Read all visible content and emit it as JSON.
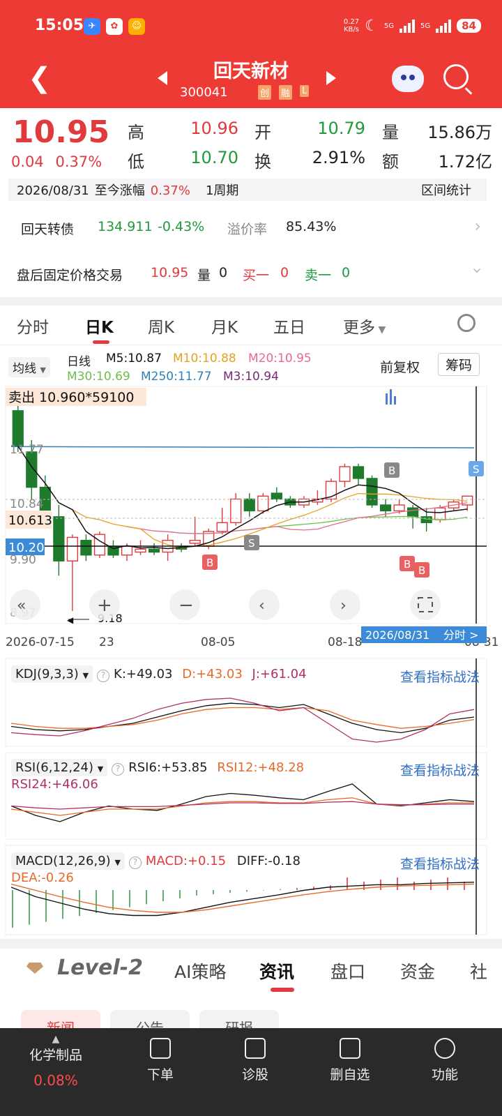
{
  "status": {
    "time": "15:05",
    "net_speed": "0.27",
    "net_unit": "KB/s",
    "sig1": "5G",
    "sig2": "5G",
    "battery": "84"
  },
  "nav": {
    "title": "回天新材",
    "code": "300041",
    "tags": [
      "创",
      "融",
      "L"
    ]
  },
  "quote": {
    "price": "10.95",
    "change": "0.04",
    "change_pct": "0.37%",
    "high_label": "高",
    "high": "10.96",
    "open_label": "开",
    "open": "10.79",
    "vol_label": "量",
    "vol": "15.86万",
    "low_label": "低",
    "low": "10.70",
    "turn_label": "换",
    "turn": "2.91%",
    "amt_label": "额",
    "amt": "1.72亿"
  },
  "range_row": {
    "date": "2026/08/31",
    "label": "至今涨幅",
    "pct": "0.37%",
    "period": "1周期",
    "stat": "区间统计"
  },
  "bond": {
    "name": "回天转债",
    "price": "134.911",
    "chg": "-0.43%",
    "premium_label": "溢价率",
    "premium": "85.43%"
  },
  "afterhours": {
    "label": "盘后固定价格交易",
    "price": "10.95",
    "vol_label": "量",
    "vol": "0",
    "buy_label": "买一",
    "buy": "0",
    "sell_label": "卖一",
    "sell": "0"
  },
  "tabs": [
    "分时",
    "日K",
    "周K",
    "月K",
    "五日",
    "更多"
  ],
  "legend": {
    "ma_btn": "均线",
    "kind": "日线",
    "m5": "M5:10.87",
    "m10": "M10:10.88",
    "m20": "M20:10.95",
    "m30": "M30:10.69",
    "m250": "M250:11.77",
    "m3": "M3:10.94",
    "fq": "前复权",
    "chip": "筹码"
  },
  "chart_labels": {
    "sell_tip": "卖出 10.960*59100",
    "y_top": "11.77",
    "y_mid": "10.84",
    "y_cross": "10.613",
    "y_cur": "10.20",
    "y_990": "9.90",
    "y_low": "8.97",
    "min_mark": "9.18",
    "x1": "2026-07-15",
    "x1b": "23",
    "x2": "08-05",
    "x3": "08-18",
    "x4": "08-31",
    "date_tip": "2026/08/31",
    "fs_tip": "分时 >"
  },
  "colors": {
    "up": "#e0393e",
    "down": "#1f7a2c",
    "m5": "#111111",
    "m10": "#e8a020",
    "m20": "#e86a8a",
    "m30": "#6cbf4a",
    "m250": "#2f7fb8",
    "m3": "#7a2a7a"
  },
  "kdj": {
    "name": "KDJ(9,3,3)",
    "k": "K:+49.03",
    "d": "D:+43.03",
    "j": "J:+61.04",
    "link": "查看指标战法"
  },
  "rsi": {
    "name": "RSI(6,12,24)",
    "r6": "RSI6:+53.85",
    "r12": "RSI12:+48.28",
    "r24": "RSI24:+46.06",
    "link": "查看指标战法"
  },
  "macd": {
    "name": "MACD(12,26,9)",
    "macd": "MACD:+0.15",
    "diff": "DIFF:-0.18",
    "dea": "DEA:-0.26",
    "link": "查看指标战法"
  },
  "level2": {
    "brand": "Level-2",
    "tabs": [
      "AI策略",
      "资讯",
      "盘口",
      "资金",
      "社"
    ]
  },
  "subtabs": [
    "新闻",
    "公告",
    "研报"
  ],
  "bottom": {
    "sector": "化学制品",
    "sector_pct": "0.08%",
    "items": [
      "下单",
      "诊股",
      "删自选",
      "功能"
    ]
  }
}
